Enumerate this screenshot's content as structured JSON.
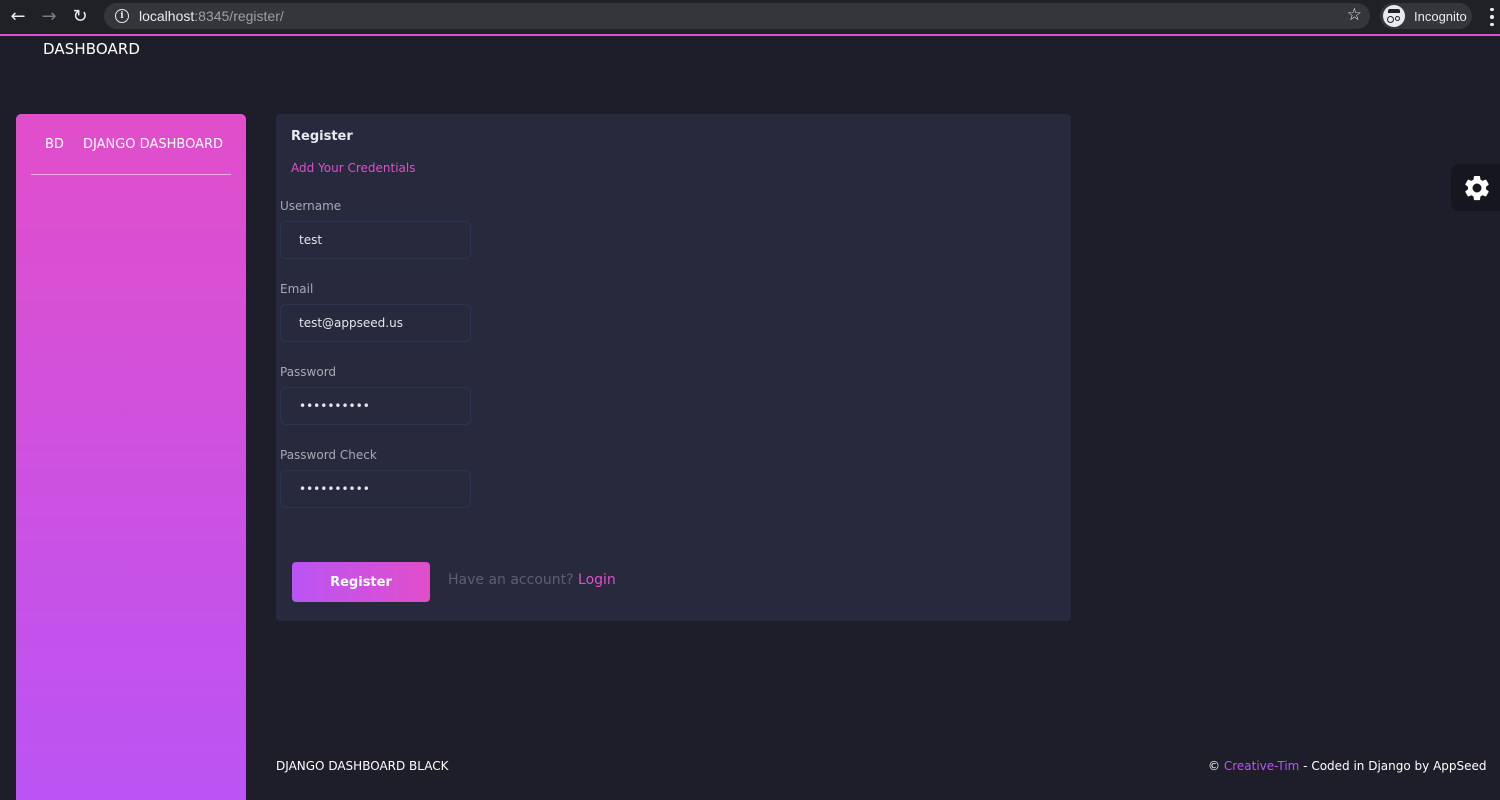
{
  "browser": {
    "url_host": "localhost",
    "url_path": ":8345/register/",
    "profile_label": "Incognito"
  },
  "topbar": {
    "title": "DASHBOARD"
  },
  "sidebar": {
    "logo_mini": "BD",
    "logo_text": "DJANGO DASHBOARD"
  },
  "card": {
    "title": "Register",
    "subtitle": "Add Your Credentials",
    "fields": {
      "username": {
        "label": "Username",
        "value": "test"
      },
      "email": {
        "label": "Email",
        "value": "test@appseed.us"
      },
      "password": {
        "label": "Password",
        "value": "••••••••••"
      },
      "password_check": {
        "label": "Password Check",
        "value": "••••••••••"
      }
    },
    "register_label": "Register",
    "have_account_text": "Have an account?",
    "login_label": "Login"
  },
  "footer": {
    "left_text": "DJANGO DASHBOARD BLACK",
    "copyright_symbol": "©",
    "creative_tim": "Creative-Tim",
    "coded_by": " - Coded in Django by AppSeed"
  },
  "colors": {
    "primary": "#e14eca",
    "secondary": "#ba54f5",
    "background": "#1e1e2b",
    "card": "#27293d"
  }
}
